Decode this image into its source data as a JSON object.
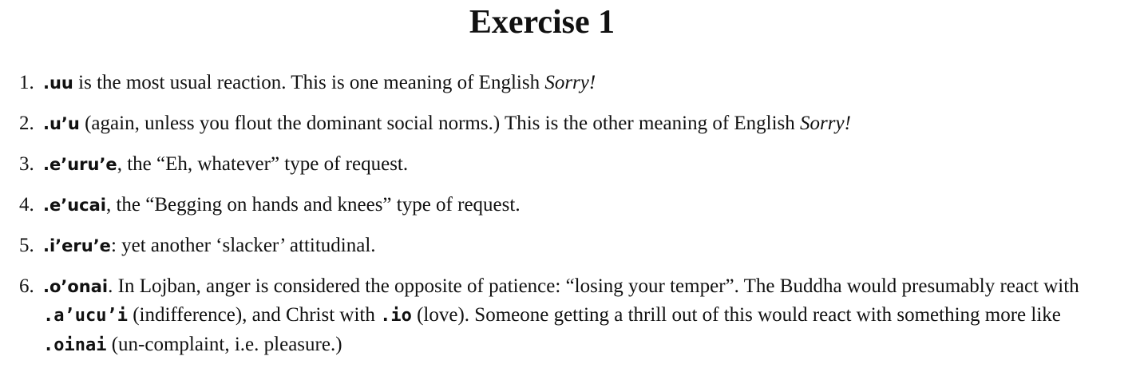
{
  "title": "Exercise 1",
  "items": [
    {
      "number": "1.",
      "word": ".uu",
      "text_a": " is the most usual reaction. This is one meaning of English ",
      "emphasis": "Sorry!"
    },
    {
      "number": "2.",
      "word": ".u’u",
      "text_a": " (again, unless you flout the dominant social norms.) This is the other meaning of English ",
      "emphasis": "Sorry!"
    },
    {
      "number": "3.",
      "word": ".e’uru’e",
      "text_a": ", the “Eh, whatever” type of request."
    },
    {
      "number": "4.",
      "word": ".e’ucai",
      "text_a": ", the “Begging on hands and knees” type of request."
    },
    {
      "number": "5.",
      "word": ".i’eru’e",
      "text_a": ": yet another ‘slacker’ attitudinal."
    },
    {
      "number": "6.",
      "word": ".o’onai",
      "text_a": ". In Lojban, anger is considered the opposite of patience: “losing your temper”. The Buddha would presumably react with ",
      "word_b": ".a’ucu’i",
      "text_b": " (indifference), and Christ with ",
      "word_c": ".io",
      "text_c": " (love). Someone getting a thrill out of this would react with something more like ",
      "word_d": ".oinai",
      "text_d": " (un-complaint, i.e. pleasure.)"
    }
  ]
}
